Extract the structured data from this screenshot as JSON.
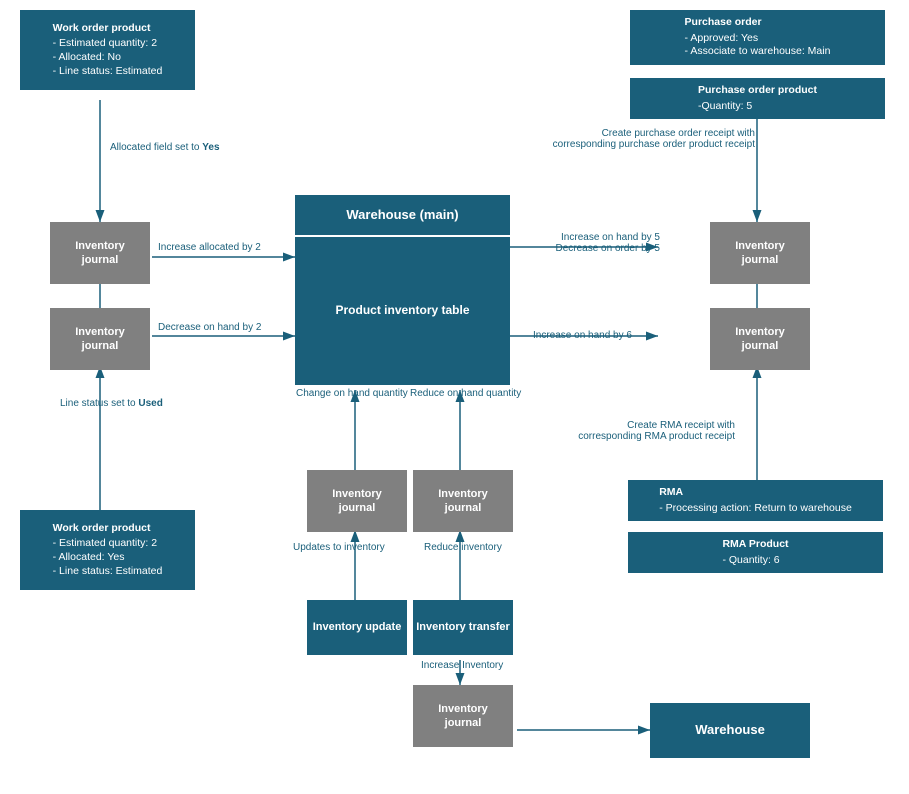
{
  "boxes": {
    "work_order_top": {
      "title": "Work order product",
      "lines": [
        "- Estimated quantity: 2",
        "- Allocated: No",
        "- Line status: Estimated"
      ]
    },
    "work_order_bottom": {
      "title": "Work order product",
      "lines": [
        "- Estimated quantity: 2",
        "- Allocated: Yes",
        "- Line status: Estimated"
      ]
    },
    "purchase_order": {
      "title": "Purchase order",
      "lines": [
        "- Approved: Yes",
        "- Associate to warehouse: Main"
      ]
    },
    "purchase_order_product": {
      "title": "Purchase order product",
      "lines": [
        "-Quantity: 5"
      ]
    },
    "rma": {
      "title": "RMA",
      "lines": [
        "- Processing action: Return to warehouse"
      ]
    },
    "rma_product": {
      "title": "RMA Product",
      "lines": [
        "- Quantity: 6"
      ]
    },
    "warehouse_main_top": "Warehouse (main)",
    "product_inventory": "Product inventory table",
    "inv_journal_1": {
      "line1": "Inventory",
      "line2": "journal"
    },
    "inv_journal_2": {
      "line1": "Inventory",
      "line2": "journal"
    },
    "inv_journal_3": {
      "line1": "Inventory",
      "line2": "journal"
    },
    "inv_journal_4": {
      "line1": "Inventory",
      "line2": "journal"
    },
    "inv_journal_5": {
      "line1": "Inventory",
      "line2": "journal"
    },
    "inv_journal_6": {
      "line1": "Inventory",
      "line2": "journal"
    },
    "inv_journal_7": {
      "line1": "Inventory",
      "line2": "journal"
    },
    "inventory_update": "Inventory update",
    "inventory_transfer": "Inventory transfer",
    "warehouse_bottom": "Warehouse"
  },
  "labels": {
    "allocated_yes": "Allocated field set to Yes",
    "line_status_used": "Line status set to Used",
    "increase_allocated": "Increase allocated by 2",
    "decrease_on_hand": "Decrease on hand by 2",
    "increase_on_hand_5": "Increase on hand by 5",
    "decrease_on_order_5": "Decrease on order by 5",
    "increase_on_hand_6": "Increase on hand by 6",
    "change_on_hand": "Change on hand quantity",
    "reduce_on_hand": "Reduce on hand quantity",
    "updates_to_inventory": "Updates to inventory",
    "reduce_inventory": "Reduce inventory",
    "increase_inventory": "Increase Inventory",
    "create_purchase_receipt": "Create purchase order receipt with",
    "create_purchase_receipt2": "corresponding purchase order product receipt",
    "create_rma_receipt": "Create RMA receipt with",
    "create_rma_receipt2": "corresponding RMA product receipt"
  },
  "colors": {
    "teal": "#1a5f7a",
    "gray": "#808080",
    "arrow": "#1a5f7a"
  }
}
